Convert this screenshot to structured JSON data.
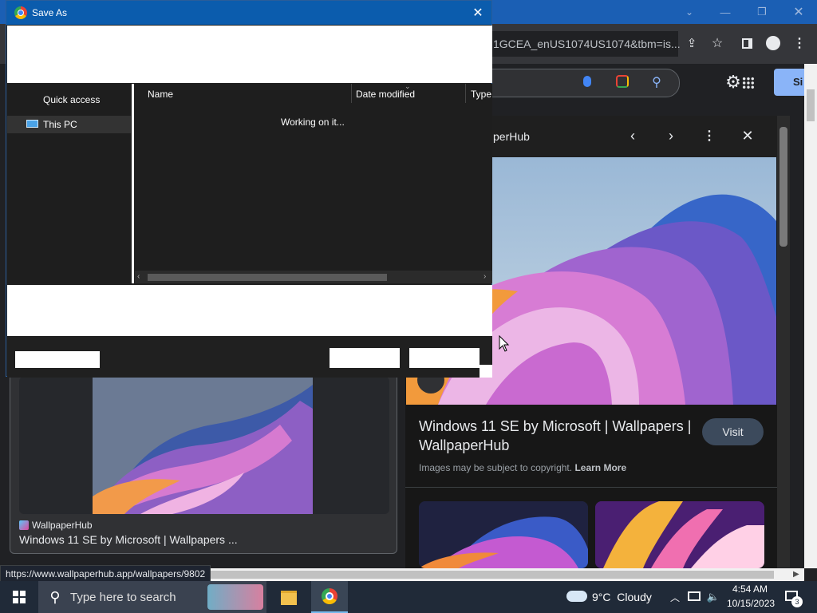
{
  "browser": {
    "address_text": "1GCEA_enUS1074US1074&tbm=is...",
    "header_partial_button": "Si"
  },
  "preview": {
    "source_partial": "perHub",
    "title": "Windows 11 SE by Microsoft | Wallpapers | WallpaperHub",
    "visit_label": "Visit",
    "copyright_text": "Images may be subject to copyright.",
    "learn_more": "Learn More"
  },
  "result_card": {
    "source": "WallpaperHub",
    "title": "Windows 11 SE by Microsoft | Wallpapers ..."
  },
  "status_url": "https://www.wallpaperhub.app/wallpapers/9802",
  "dialog": {
    "title": "Save As",
    "nav": {
      "quick_access": "Quick access",
      "this_pc": "This PC"
    },
    "columns": [
      "Name",
      "Date modified",
      "Type"
    ],
    "loading_text": "Working on it..."
  },
  "taskbar": {
    "search_placeholder": "Type here to search",
    "weather": "9°C  Cloudy",
    "time": "4:54 AM",
    "date": "10/15/2023",
    "notification_count": "3"
  }
}
